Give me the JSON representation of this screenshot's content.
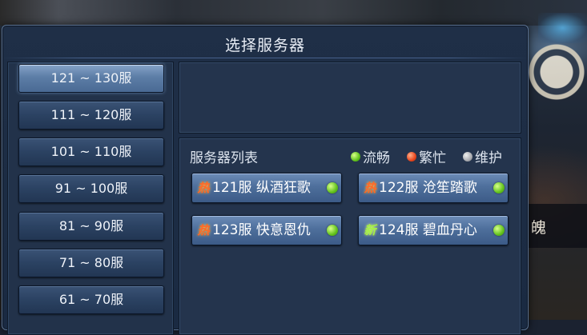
{
  "dialog": {
    "title": "选择服务器"
  },
  "ranges": [
    {
      "label": "121 ~ 130服",
      "selected": true
    },
    {
      "label": "111 ~ 120服",
      "selected": false
    },
    {
      "label": "101 ~ 110服",
      "selected": false
    },
    {
      "label": "91 ~ 100服",
      "selected": false
    },
    {
      "label": "81 ~ 90服",
      "selected": false
    },
    {
      "label": "71 ~ 80服",
      "selected": false
    },
    {
      "label": "61 ~ 70服",
      "selected": false
    }
  ],
  "server_list": {
    "title": "服务器列表",
    "legend": {
      "smooth": "流畅",
      "busy": "繁忙",
      "maintenance": "维护"
    },
    "servers": [
      {
        "tag": "热",
        "tag_type": "hot",
        "name": "121服 纵酒狂歌",
        "status": "smooth"
      },
      {
        "tag": "热",
        "tag_type": "hot",
        "name": "122服 沧笙踏歌",
        "status": "smooth"
      },
      {
        "tag": "热",
        "tag_type": "hot",
        "name": "123服 快意恩仇",
        "status": "smooth"
      },
      {
        "tag": "新",
        "tag_type": "new",
        "name": "124服 碧血丹心",
        "status": "smooth"
      }
    ]
  },
  "background": {
    "partial_text": "魄"
  },
  "colors": {
    "status_smooth": "#62c21c",
    "status_busy": "#e8461d",
    "status_maintenance": "#a9abb0"
  }
}
